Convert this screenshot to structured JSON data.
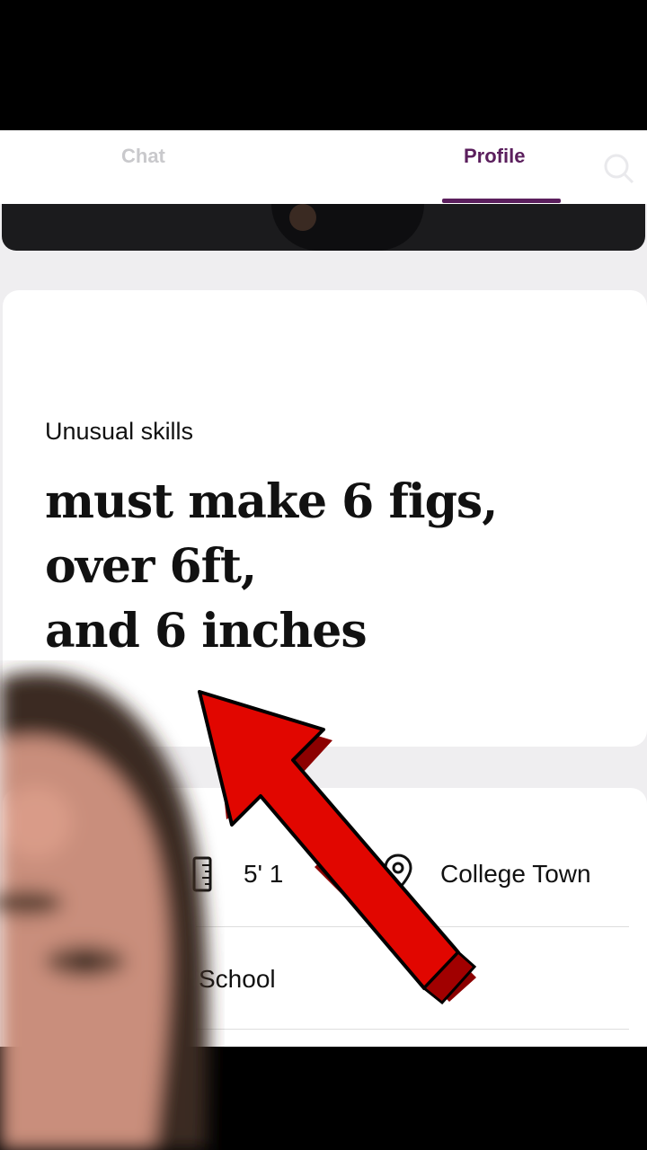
{
  "tabs": {
    "chat_label": "Chat",
    "profile_label": "Profile"
  },
  "prompt": {
    "label": "Unusual skills",
    "answer_line1": "must make 6 figs,",
    "answer_line2": "over 6ft,",
    "answer_line3": "and 6 inches"
  },
  "details": {
    "height": "5' 1",
    "location": "College Town",
    "school": "School"
  },
  "colors": {
    "accent": "#5b1f5d",
    "arrow": "#e00000"
  },
  "icons": [
    "search-icon",
    "ruler-icon",
    "location-pin-icon",
    "arrow-overlay"
  ]
}
